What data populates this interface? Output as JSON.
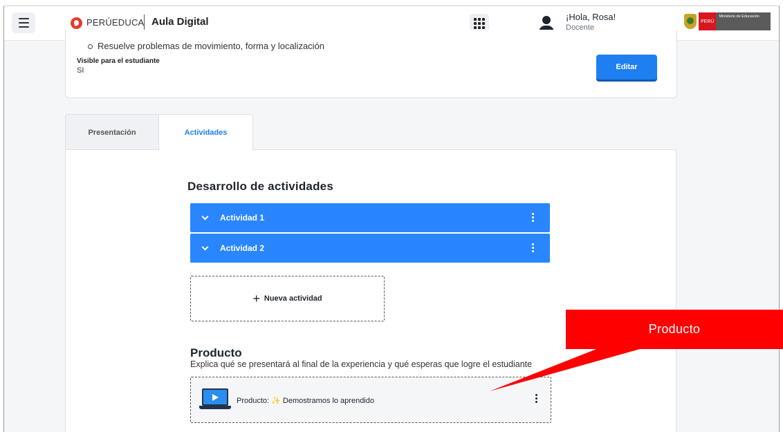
{
  "header": {
    "brand_name": "PERÚEDUCA",
    "app_title": "Aula Digital",
    "greeting": "¡Hola, Rosa!",
    "role": "Docente",
    "peru_label": "PERÚ",
    "ministry_label": "Ministerio de Educación"
  },
  "info_card": {
    "bullet_text": "Resuelve problemas de movimiento, forma y localización",
    "visible_label": "Visible para el estudiante",
    "visible_value": "SI",
    "edit_label": "Editar"
  },
  "tabs": [
    {
      "label": "Presentación",
      "active": false
    },
    {
      "label": "Actividades",
      "active": true
    }
  ],
  "activities_section": {
    "title": "Desarrollo de actividades",
    "items": [
      {
        "label": "Actividad 1"
      },
      {
        "label": "Actividad 2"
      }
    ],
    "new_activity_label": "Nueva actividad"
  },
  "product_section": {
    "title": "Producto",
    "description": "Explica qué se presentará al final de la experiencia y qué esperas que logre el estudiante",
    "item_prefix": "Producto:",
    "item_sparkle": "✨",
    "item_name": "Demostramos lo aprendido"
  },
  "callout": {
    "text": "Producto",
    "color": "#ff0000"
  },
  "colors": {
    "primary": "#1e7ff0",
    "activity_bar": "#2a86ff"
  }
}
